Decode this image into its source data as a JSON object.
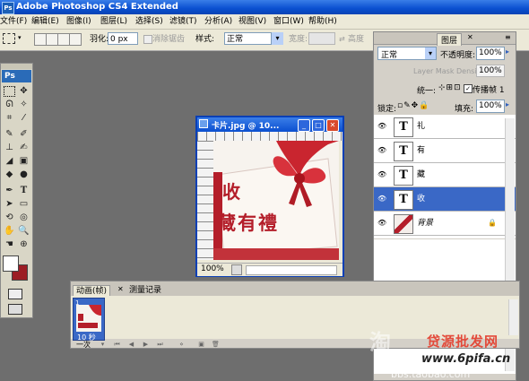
{
  "app": {
    "title": "Adobe Photoshop CS4 Extended",
    "logo_text": "Ps"
  },
  "menu": [
    "文件(F)",
    "编辑(E)",
    "图像(I)",
    "图层(L)",
    "选择(S)",
    "滤镜(T)",
    "分析(A)",
    "视图(V)",
    "窗口(W)",
    "帮助(H)"
  ],
  "options_bar": {
    "feather_label": "羽化:",
    "feather_value": "0 px",
    "antialias_label": "消除锯齿",
    "style_label": "样式:",
    "style_value": "正常",
    "width_label": "宽度:",
    "height_label": "高度"
  },
  "document": {
    "title": "卡片.jpg @ 10...",
    "zoom": "100%",
    "canvas_text_line1": "收",
    "canvas_text_line2": "藏有禮"
  },
  "layers_panel": {
    "tab_label": "图层",
    "blend_mode": "正常",
    "opacity_label": "不透明度:",
    "opacity_value": "100%",
    "layer_mask_density_label": "Layer Mask Density",
    "layer_mask_density_value": "100%",
    "unify_label": "统一:",
    "propagate_label": "传播帧 1",
    "lock_label": "锁定:",
    "fill_label": "填充:",
    "fill_value": "100%",
    "layers": [
      {
        "name": "礼",
        "type": "text",
        "selected": false
      },
      {
        "name": "有",
        "type": "text",
        "selected": false
      },
      {
        "name": "藏",
        "type": "text",
        "selected": false
      },
      {
        "name": "收",
        "type": "text",
        "selected": true
      },
      {
        "name": "背景",
        "type": "image",
        "selected": false
      }
    ]
  },
  "animation_panel": {
    "tab_animation": "动画(帧)",
    "tab_history": "测量记录",
    "frame_number": "1",
    "frame_delay": "10 秒",
    "loop_value": "一次"
  },
  "watermarks": {
    "site_text": "贷源批发网",
    "site_url": "www.6pifa.cn",
    "bbs_url": "bbs.taobao.com",
    "taobao_char": "淘"
  },
  "colors": {
    "title_blue": "#0a4fd0",
    "selected_layer": "#3a68c6",
    "canvas_red": "#b41e2a"
  }
}
